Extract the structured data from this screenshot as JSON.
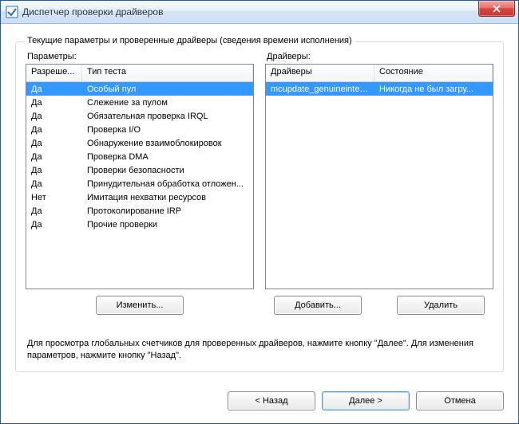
{
  "window": {
    "title": "Диспетчер проверки драйверов"
  },
  "group": {
    "legend": "Текущие параметры и проверенные драйверы (сведения времени исполнения)"
  },
  "paramsPanel": {
    "label": "Параметры:",
    "headers": {
      "allowed": "Разреше...",
      "test": "Тип теста"
    },
    "rows": [
      {
        "allowed": "Да",
        "test": "Особый пул",
        "selected": true
      },
      {
        "allowed": "Да",
        "test": "Слежение за пулом"
      },
      {
        "allowed": "Да",
        "test": "Обязательная проверка IRQL"
      },
      {
        "allowed": "Да",
        "test": "Проверка I/O"
      },
      {
        "allowed": "Да",
        "test": "Обнаружение взаимоблокировок"
      },
      {
        "allowed": "Да",
        "test": "Проверка DMA"
      },
      {
        "allowed": "Да",
        "test": "Проверки безопасности"
      },
      {
        "allowed": "Да",
        "test": "Принудительная обработка отложен..."
      },
      {
        "allowed": "Нет",
        "test": "Имитация нехватки ресурсов"
      },
      {
        "allowed": "Да",
        "test": "Протоколирование IRP"
      },
      {
        "allowed": "Да",
        "test": "Прочие проверки"
      }
    ],
    "changeBtn": "Изменить..."
  },
  "driversPanel": {
    "label": "Драйверы:",
    "headers": {
      "driver": "Драйверы",
      "state": "Состояние"
    },
    "rows": [
      {
        "driver": "mcupdate_genuineintel.dll",
        "state": "Никогда не был загру...",
        "selected": true
      }
    ],
    "addBtn": "Добавить...",
    "removeBtn": "Удалить"
  },
  "hint": "Для просмотра глобальных счетчиков для проверенных драйверов, нажмите кнопку \"Далее\". Для изменения параметров, нажмите кнопку \"Назад\".",
  "footer": {
    "back": "< Назад",
    "next": "Далее >",
    "cancel": "Отмена"
  }
}
